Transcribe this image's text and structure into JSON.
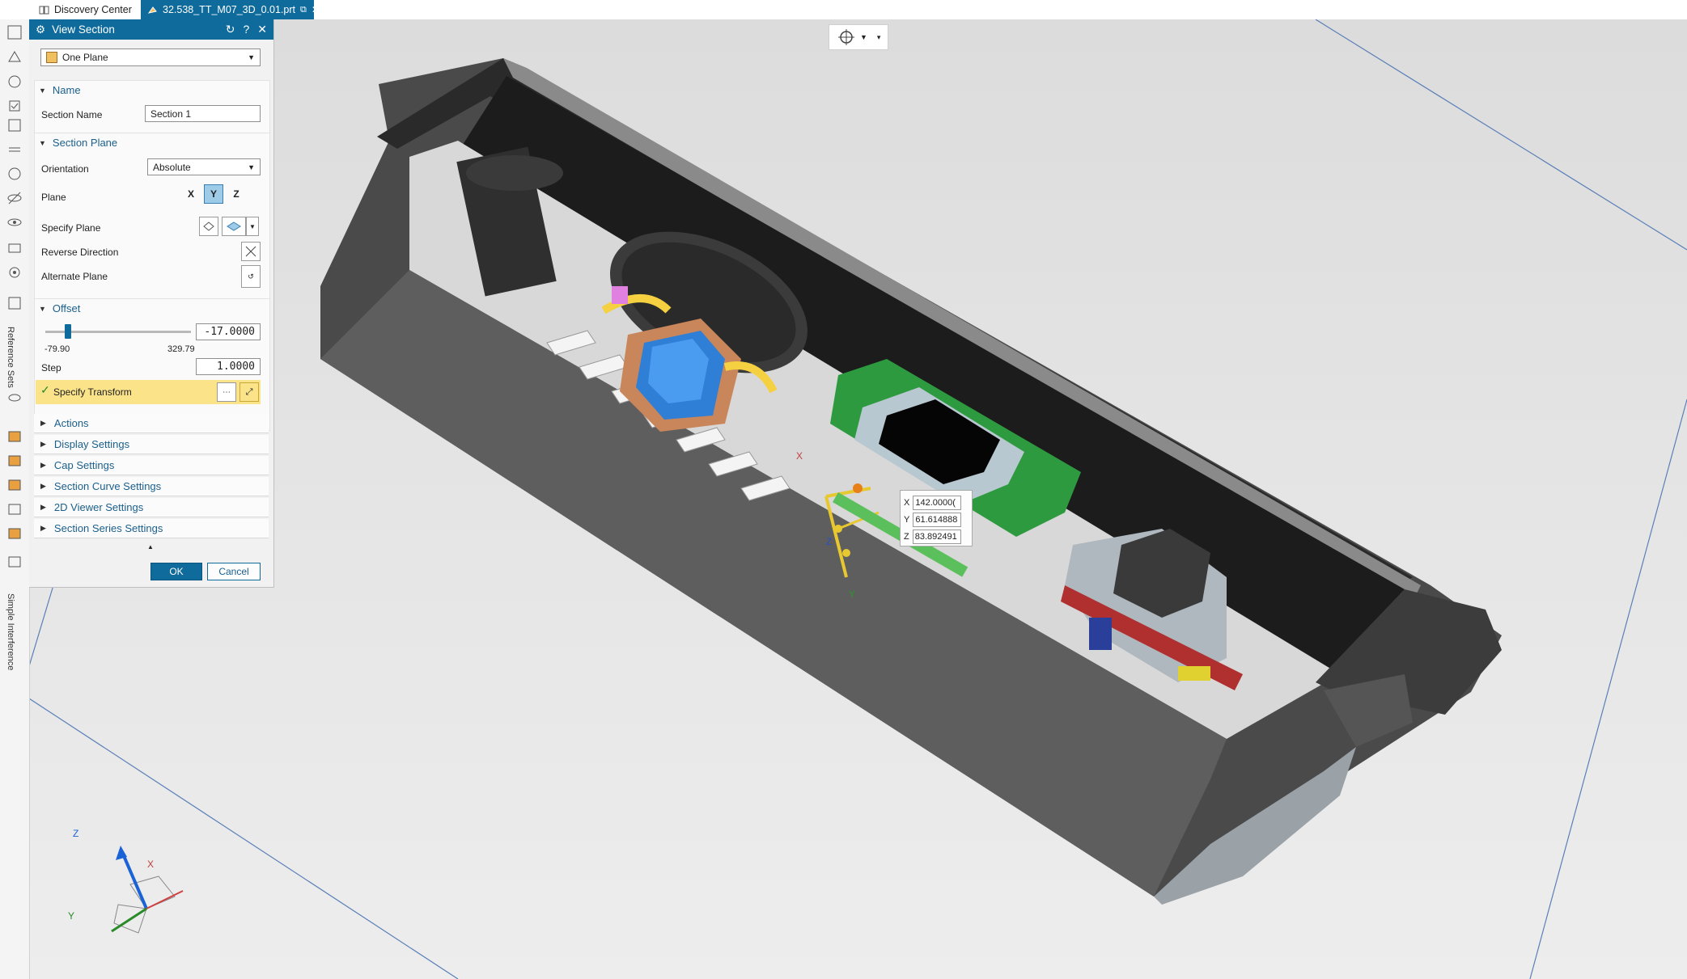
{
  "tabs": [
    {
      "label": "Discovery Center",
      "icon": "book-icon"
    },
    {
      "label": "32.538_TT_M07_3D_0.01.prt",
      "icon": "part-icon"
    }
  ],
  "left_toolbar": {
    "vertical_labels": [
      "Reference Sets",
      "Simple Interference"
    ]
  },
  "dialog": {
    "title": "View Section",
    "type_select": "One Plane",
    "sections": {
      "name": {
        "header": "Name",
        "section_name_label": "Section Name",
        "section_name_value": "Section 1"
      },
      "section_plane": {
        "header": "Section Plane",
        "orientation_label": "Orientation",
        "orientation_value": "Absolute",
        "plane_label": "Plane",
        "plane_buttons": [
          "X",
          "Y",
          "Z"
        ],
        "specify_plane_label": "Specify Plane",
        "reverse_direction_label": "Reverse Direction",
        "alternate_plane_label": "Alternate Plane"
      },
      "offset": {
        "header": "Offset",
        "value": "-17.0000",
        "min_label": "-79.90",
        "max_label": "329.79",
        "slider_level": 0.153,
        "step_label": "Step",
        "step_value": "1.0000",
        "specify_transform_label": "Specify Transform"
      }
    },
    "collapsed_sections": [
      "Actions",
      "Display Settings",
      "Cap Settings",
      "Section Curve Settings",
      "2D Viewer Settings",
      "Section Series Settings"
    ],
    "ok_label": "OK",
    "cancel_label": "Cancel"
  },
  "coordinates": {
    "x_label": "X",
    "x_value": "142.0000(",
    "y_label": "Y",
    "y_value": "61.614888",
    "z_label": "Z",
    "z_value": "83.892491"
  },
  "triad": {
    "x": "X",
    "y": "Y",
    "z": "Z"
  },
  "manipulator_axes": {
    "x": "X",
    "y": "Y",
    "z": "Z"
  },
  "colors": {
    "accent": "#0e6b9c",
    "highlight": "#fbe38a",
    "model_dark": "#3a3a3a"
  }
}
